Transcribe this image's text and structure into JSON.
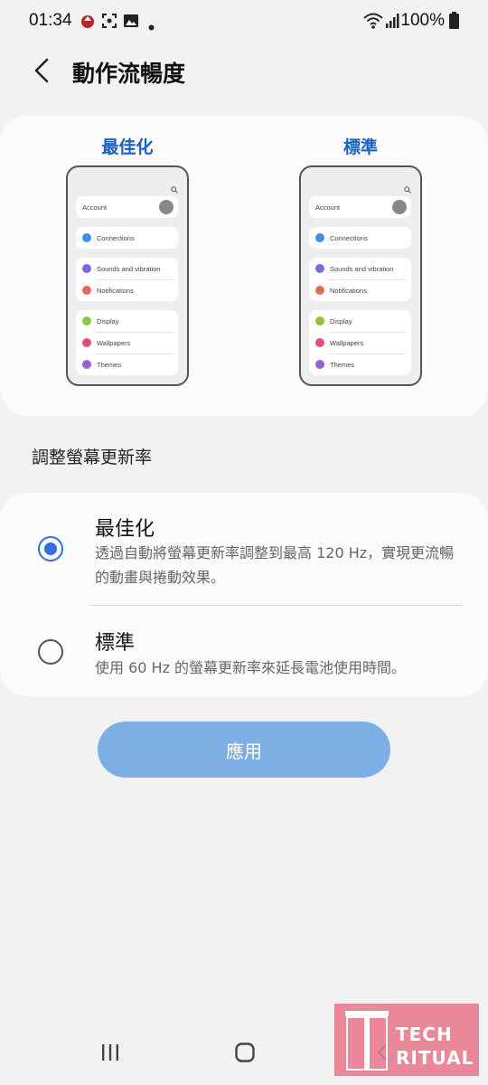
{
  "status_bar": {
    "time": "01:34",
    "battery": "100%"
  },
  "header": {
    "title": "動作流暢度"
  },
  "preview": {
    "left_label": "最佳化",
    "right_label": "標準",
    "mini_settings": {
      "account": "Account",
      "connections": "Connections",
      "sounds": "Sounds and vibration",
      "notifications": "Notifications",
      "display": "Display",
      "wallpapers": "Wallpapers",
      "themes": "Themes"
    }
  },
  "section_label": "調整螢幕更新率",
  "options": [
    {
      "title": "最佳化",
      "description": "透過自動將螢幕更新率調整到最高 120 Hz，實現更流暢的動畫與捲動效果。",
      "selected": true
    },
    {
      "title": "標準",
      "description": "使用 60 Hz 的螢幕更新率來延長電池使用時間。",
      "selected": false
    }
  ],
  "apply_label": "應用",
  "watermark": {
    "line1": "TECH",
    "line2": "RITUAL"
  },
  "colors": {
    "accent": "#2f6fe0",
    "label_blue": "#1a5fc2",
    "apply_button": "#7eafe4",
    "watermark": "#e8788c"
  }
}
